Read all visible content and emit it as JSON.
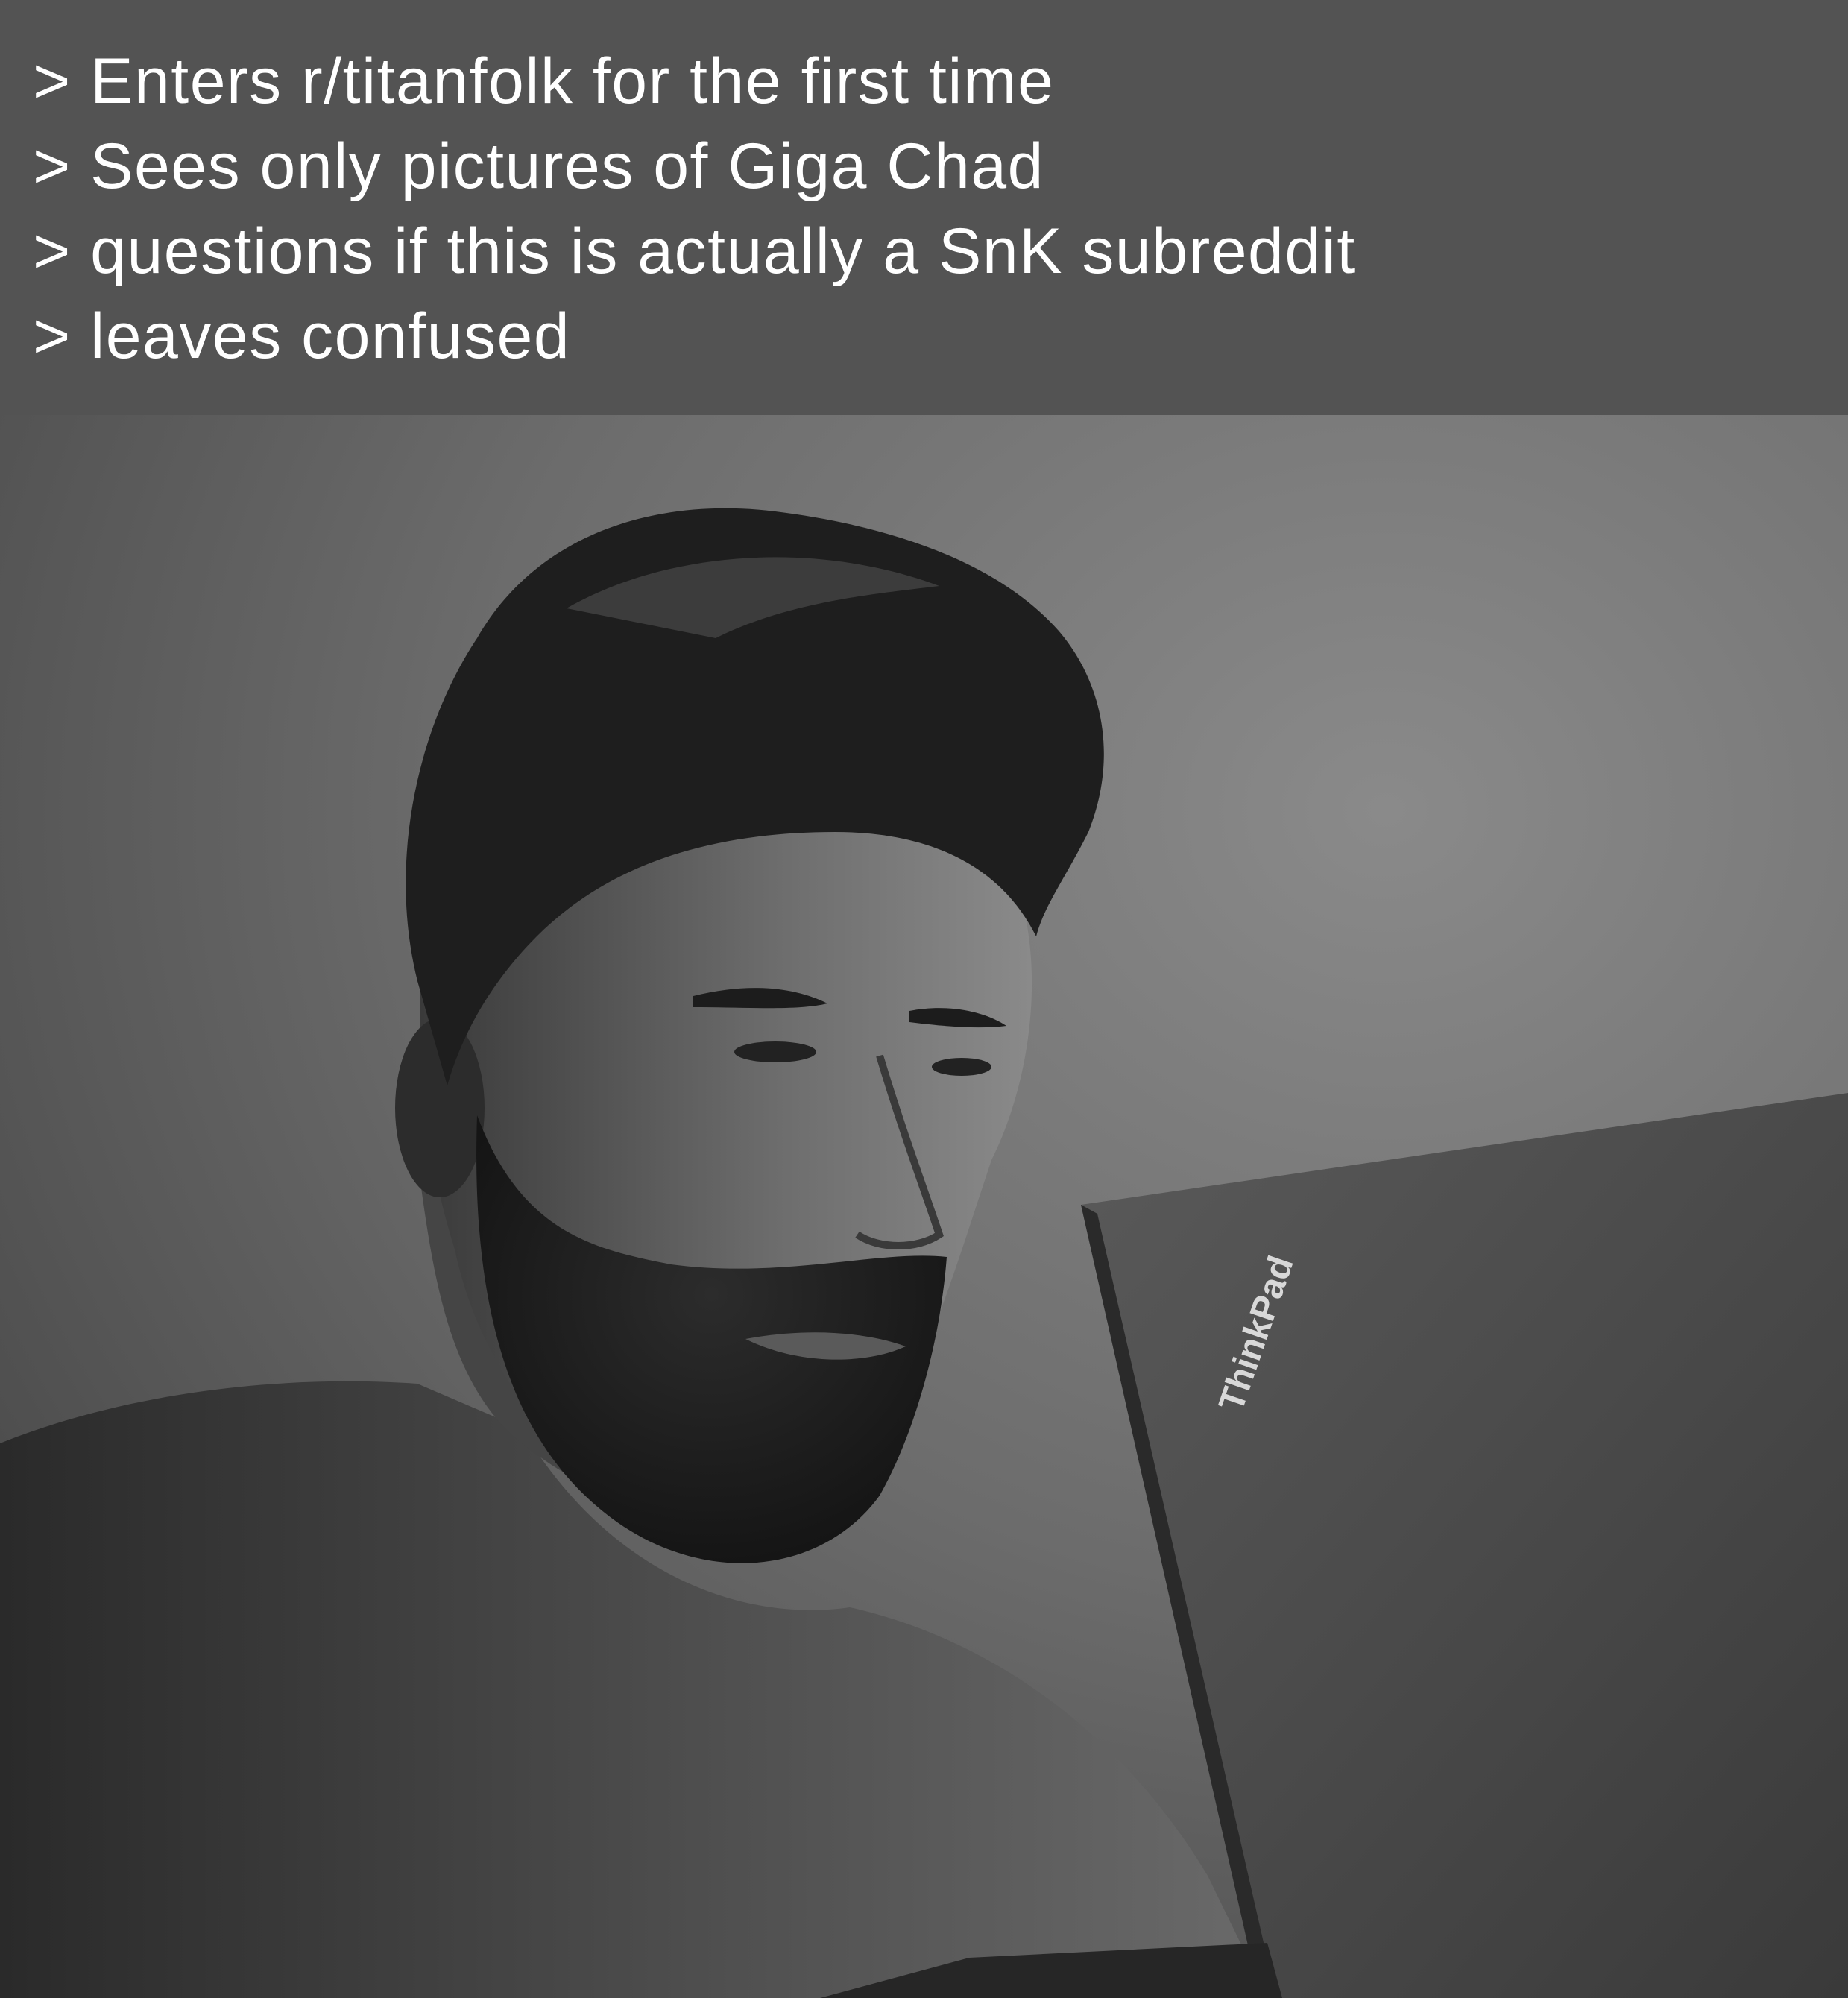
{
  "caption": {
    "lines": [
      "> Enters r/titanfolk for the first time",
      "> Sees only pictures of Giga Chad",
      "> questions if this is actually a SnK subreddit",
      "> leaves confused"
    ]
  },
  "photo": {
    "laptop_brand": "ThinkPad"
  },
  "colors": {
    "caption_background": "#535353",
    "caption_text": "#ffffff"
  }
}
